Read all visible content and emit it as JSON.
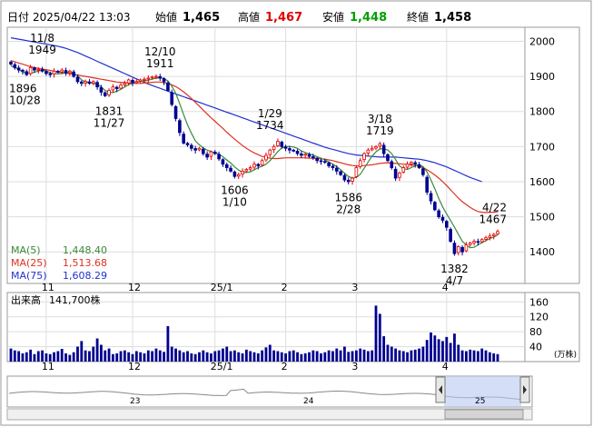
{
  "header": {
    "date_label": "日付",
    "datetime": "2025/04/22 13:03",
    "open_label": "始値",
    "open_value": "1,465",
    "high_label": "高値",
    "high_value": "1,467",
    "low_label": "安値",
    "low_value": "1,448",
    "close_label": "終値",
    "close_value": "1,458"
  },
  "colors": {
    "up": "#e00000",
    "down": "#000090",
    "ma5": "#3a8a3a",
    "ma25": "#e03020",
    "ma75": "#2030d0",
    "volume": "#000090",
    "nav_fill": "#b8c8f0"
  },
  "legend": [
    {
      "name": "MA(5)",
      "value": "1,448.40",
      "color": "#3a8a3a"
    },
    {
      "name": "MA(25)",
      "value": "1,513.68",
      "color": "#e03020"
    },
    {
      "name": "MA(75)",
      "value": "1,608.29",
      "color": "#2030d0"
    }
  ],
  "volume_label": "出来高",
  "volume_value": "141,700株",
  "volume_unit": "(万株)",
  "navigator_labels": [
    "23",
    "24",
    "25"
  ],
  "chart_data": {
    "type": "candlestick",
    "price_axis": {
      "ticks": [
        1400,
        1500,
        1600,
        1700,
        1800,
        1900,
        2000
      ],
      "ylim": [
        1310,
        2040
      ]
    },
    "x_tick_labels": [
      "11",
      "12",
      "25/1",
      "2",
      "3",
      "4"
    ],
    "volume_axis": {
      "ticks": [
        40,
        80,
        120,
        160
      ],
      "ylim": [
        0,
        185
      ]
    },
    "annotations": [
      {
        "lines": [
          "11/8",
          "1949"
        ],
        "date": "11/8",
        "value": 1949,
        "kind": "high"
      },
      {
        "lines": [
          "1896",
          "10/28"
        ],
        "date": "10/28",
        "value": 1896,
        "kind": "low"
      },
      {
        "lines": [
          "12/10",
          "1911"
        ],
        "date": "12/10",
        "value": 1911,
        "kind": "high"
      },
      {
        "lines": [
          "1831",
          "11/27"
        ],
        "date": "11/27",
        "value": 1831,
        "kind": "low"
      },
      {
        "lines": [
          "1/29",
          "1734"
        ],
        "date": "1/29",
        "value": 1734,
        "kind": "high"
      },
      {
        "lines": [
          "1606",
          "1/10"
        ],
        "date": "1/10",
        "value": 1606,
        "kind": "low"
      },
      {
        "lines": [
          "3/18",
          "1719"
        ],
        "date": "3/18",
        "value": 1719,
        "kind": "high"
      },
      {
        "lines": [
          "1586",
          "2/28"
        ],
        "date": "2/28",
        "value": 1586,
        "kind": "low"
      },
      {
        "lines": [
          "4/22",
          "1467"
        ],
        "date": "4/22",
        "value": 1467,
        "kind": "high"
      },
      {
        "lines": [
          "1382",
          "4/7"
        ],
        "date": "4/7",
        "value": 1382,
        "kind": "low"
      }
    ],
    "close": [
      1935,
      1925,
      1918,
      1915,
      1905,
      1925,
      1918,
      1920,
      1915,
      1908,
      1905,
      1915,
      1912,
      1918,
      1910,
      1915,
      1900,
      1885,
      1880,
      1885,
      1880,
      1885,
      1870,
      1855,
      1845,
      1860,
      1870,
      1865,
      1875,
      1880,
      1890,
      1882,
      1886,
      1890,
      1892,
      1895,
      1898,
      1900,
      1895,
      1885,
      1860,
      1820,
      1780,
      1740,
      1710,
      1705,
      1695,
      1690,
      1695,
      1680,
      1670,
      1685,
      1680,
      1665,
      1650,
      1640,
      1630,
      1615,
      1620,
      1630,
      1635,
      1640,
      1650,
      1645,
      1660,
      1675,
      1690,
      1700,
      1715,
      1700,
      1695,
      1690,
      1688,
      1680,
      1675,
      1678,
      1672,
      1668,
      1660,
      1658,
      1655,
      1645,
      1640,
      1630,
      1620,
      1605,
      1600,
      1610,
      1640,
      1660,
      1680,
      1690,
      1695,
      1700,
      1708,
      1680,
      1660,
      1640,
      1610,
      1625,
      1640,
      1650,
      1655,
      1650,
      1640,
      1620,
      1570,
      1545,
      1520,
      1500,
      1490,
      1470,
      1430,
      1395,
      1415,
      1400,
      1420,
      1425,
      1430,
      1428,
      1435,
      1440,
      1445,
      1450,
      1458
    ],
    "volume": [
      35,
      30,
      28,
      22,
      25,
      32,
      20,
      28,
      30,
      22,
      20,
      25,
      28,
      34,
      22,
      18,
      25,
      40,
      55,
      30,
      28,
      40,
      62,
      45,
      30,
      35,
      20,
      22,
      28,
      30,
      25,
      20,
      28,
      25,
      22,
      30,
      28,
      35,
      30,
      26,
      95,
      40,
      35,
      30,
      25,
      28,
      22,
      20,
      25,
      30,
      25,
      22,
      28,
      30,
      35,
      40,
      28,
      30,
      25,
      22,
      32,
      28,
      25,
      22,
      30,
      38,
      45,
      30,
      28,
      25,
      22,
      28,
      30,
      25,
      20,
      22,
      25,
      30,
      28,
      22,
      25,
      30,
      28,
      35,
      30,
      40,
      26,
      28,
      30,
      35,
      32,
      28,
      30,
      150,
      128,
      68,
      45,
      40,
      35,
      30,
      28,
      25,
      30,
      32,
      35,
      40,
      58,
      78,
      70,
      60,
      55,
      66,
      50,
      75,
      45,
      30,
      28,
      32,
      30,
      28,
      35,
      30,
      25,
      22,
      20
    ],
    "ma5": [
      1930,
      1926,
      1920,
      1912,
      1910,
      1908,
      1912,
      1915,
      1918,
      1916,
      1910,
      1908,
      1907,
      1908,
      1910,
      1912,
      1908,
      1902,
      1890,
      1885,
      1883,
      1880,
      1878,
      1870,
      1860,
      1855,
      1854,
      1858,
      1863,
      1870,
      1877,
      1880,
      1883,
      1886,
      1887,
      1889,
      1892,
      1895,
      1896,
      1894,
      1887,
      1872,
      1852,
      1822,
      1791,
      1762,
      1738,
      1716,
      1705,
      1696,
      1690,
      1686,
      1683,
      1678,
      1671,
      1662,
      1653,
      1642,
      1633,
      1627,
      1626,
      1628,
      1634,
      1640,
      1644,
      1650,
      1660,
      1672,
      1686,
      1696,
      1700,
      1700,
      1699,
      1695,
      1688,
      1683,
      1679,
      1676,
      1671,
      1667,
      1662,
      1656,
      1650,
      1643,
      1634,
      1624,
      1615,
      1610,
      1612,
      1621,
      1638,
      1656,
      1673,
      1685,
      1693,
      1694,
      1690,
      1680,
      1663,
      1645,
      1637,
      1635,
      1640,
      1645,
      1648,
      1643,
      1628,
      1605,
      1580,
      1552,
      1528,
      1508,
      1490,
      1470,
      1450,
      1430,
      1420,
      1412,
      1413,
      1420,
      1426,
      1432,
      1438,
      1442,
      1448
    ],
    "ma25": [
      1945,
      1942,
      1938,
      1935,
      1931,
      1928,
      1925,
      1923,
      1921,
      1919,
      1917,
      1915,
      1913,
      1911,
      1909,
      1908,
      1906,
      1904,
      1902,
      1900,
      1898,
      1896,
      1894,
      1892,
      1890,
      1888,
      1886,
      1884,
      1883,
      1882,
      1881,
      1880,
      1880,
      1880,
      1881,
      1882,
      1883,
      1884,
      1884,
      1882,
      1880,
      1876,
      1871,
      1864,
      1856,
      1847,
      1837,
      1826,
      1815,
      1804,
      1793,
      1782,
      1772,
      1762,
      1752,
      1741,
      1731,
      1721,
      1712,
      1703,
      1695,
      1688,
      1682,
      1677,
      1672,
      1669,
      1667,
      1666,
      1666,
      1667,
      1668,
      1668,
      1668,
      1668,
      1668,
      1668,
      1667,
      1667,
      1666,
      1665,
      1664,
      1662,
      1660,
      1657,
      1654,
      1651,
      1648,
      1646,
      1645,
      1645,
      1646,
      1647,
      1648,
      1650,
      1652,
      1653,
      1654,
      1653,
      1652,
      1651,
      1650,
      1649,
      1648,
      1646,
      1644,
      1640,
      1634,
      1627,
      1619,
      1610,
      1600,
      1589,
      1577,
      1565,
      1553,
      1543,
      1535,
      1527,
      1520,
      1515,
      1513,
      1512,
      1513,
      1513,
      1514
    ],
    "ma75": [
      2010,
      2008,
      2006,
      2004,
      2002,
      2000,
      1998,
      1996,
      1994,
      1992,
      1990,
      1988,
      1986,
      1983,
      1980,
      1976,
      1972,
      1968,
      1963,
      1958,
      1953,
      1948,
      1943,
      1938,
      1933,
      1928,
      1923,
      1918,
      1913,
      1908,
      1903,
      1898,
      1893,
      1888,
      1883,
      1878,
      1874,
      1870,
      1866,
      1862,
      1858,
      1854,
      1850,
      1846,
      1842,
      1838,
      1834,
      1830,
      1826,
      1822,
      1818,
      1814,
      1810,
      1806,
      1802,
      1798,
      1794,
      1790,
      1786,
      1782,
      1778,
      1774,
      1770,
      1766,
      1762,
      1758,
      1754,
      1750,
      1746,
      1742,
      1738,
      1734,
      1730,
      1726,
      1722,
      1718,
      1714,
      1710,
      1706,
      1702,
      1698,
      1695,
      1692,
      1689,
      1686,
      1683,
      1680,
      1678,
      1676,
      1675,
      1674,
      1673,
      1672,
      1671,
      1670,
      1670,
      1670,
      1670,
      1670,
      1669,
      1668,
      1667,
      1666,
      1665,
      1664,
      1662,
      1660,
      1657,
      1654,
      1650,
      1646,
      1642,
      1637,
      1632,
      1627,
      1622,
      1617,
      1612,
      1608,
      1604,
      1600
    ]
  }
}
